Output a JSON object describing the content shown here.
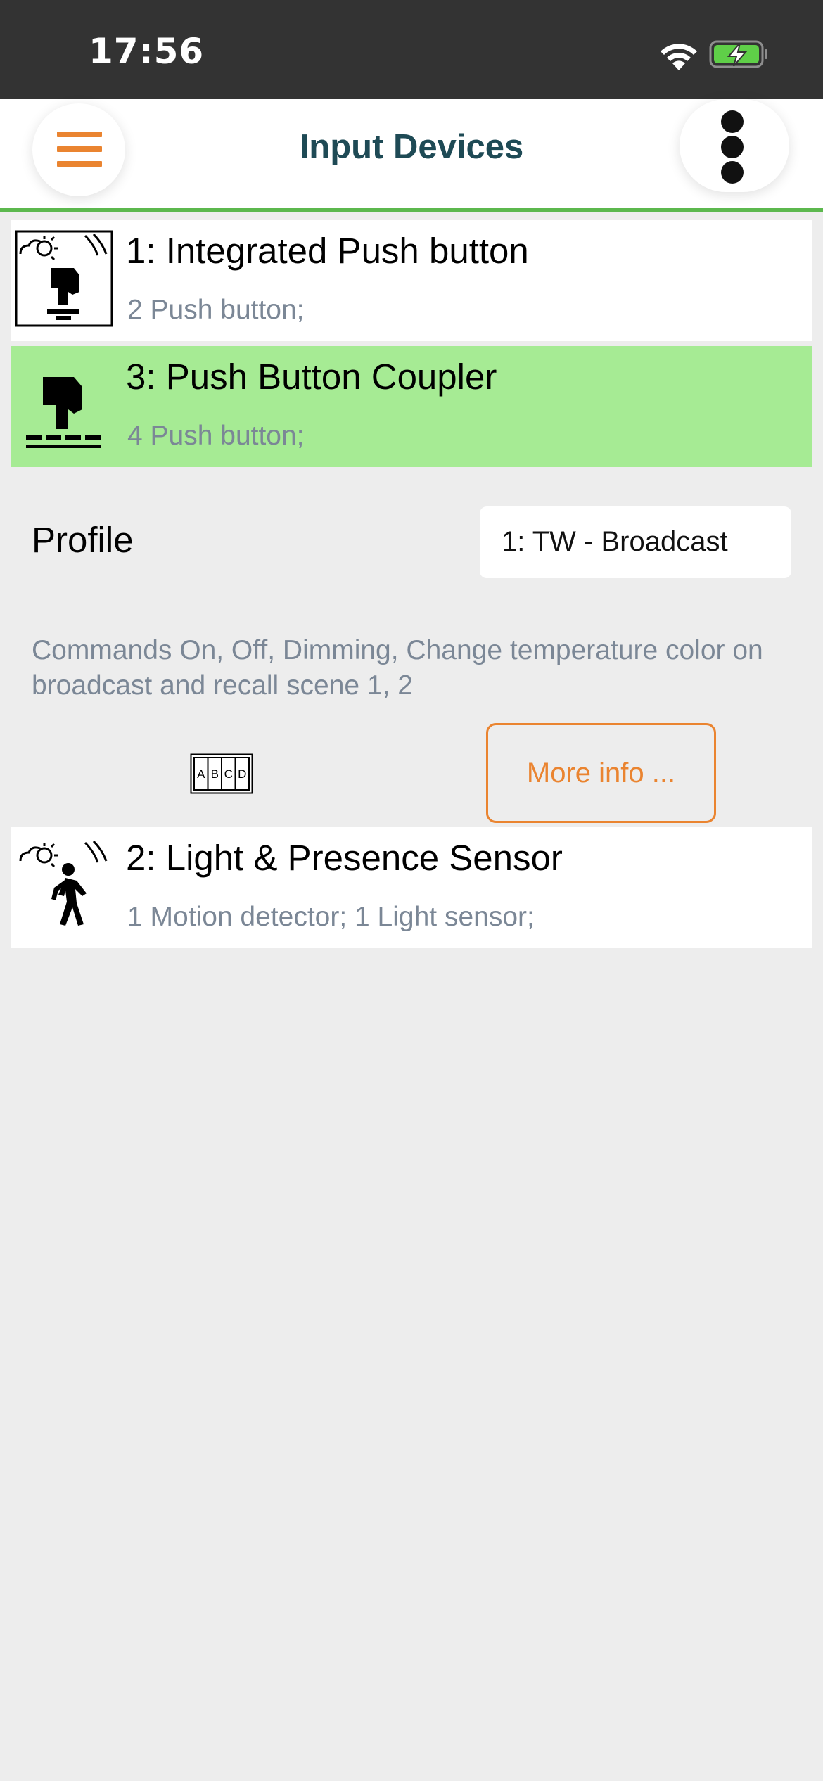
{
  "status_bar": {
    "time": "17:56",
    "icons": [
      "wifi-icon",
      "battery-charging-icon"
    ]
  },
  "header": {
    "title": "Input Devices",
    "menu_icon": "hamburger-icon",
    "more_icon": "kebab-menu-icon"
  },
  "colors": {
    "accent": "#ea8430",
    "header_rule": "#5cb84e",
    "selected_row": "#a6eb94",
    "title_text": "#1e4a55",
    "muted_text": "#7b8796",
    "status_bar": "#333333",
    "background": "#ededed"
  },
  "devices": [
    {
      "title": "1: Integrated Push button",
      "subtitle": "2 Push button;",
      "icon": "integrated-push-button-icon",
      "selected": false
    },
    {
      "title": "3: Push Button Coupler",
      "subtitle": "4 Push button;",
      "icon": "push-button-coupler-icon",
      "selected": true
    },
    {
      "title": "2: Light & Presence Sensor",
      "subtitle": "1 Motion detector; 1 Light sensor;",
      "icon": "light-presence-sensor-icon",
      "selected": false
    }
  ],
  "profile": {
    "label": "Profile",
    "selected_value": "1: TW - Broadcast",
    "description": "Commands On, Off, Dimming, Change temperature color on broadcast and recall scene 1, 2",
    "keypad_icon": "abcd-keypad-icon",
    "keypad_letters": [
      "A",
      "B",
      "C",
      "D"
    ],
    "more_info_label": "More info ..."
  }
}
